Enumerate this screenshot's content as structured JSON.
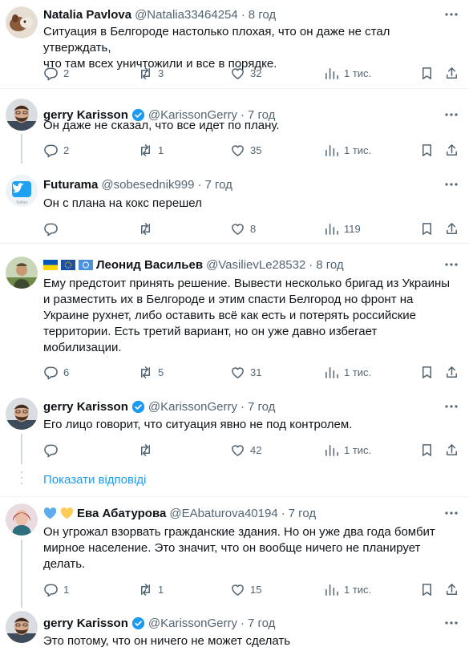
{
  "tweets": [
    {
      "name": "Natalia Pavlova",
      "handle": "@Natalia33464254",
      "time": "8 год",
      "text": "Ситуация в Белгороде настолько плохая, что он даже не стал утверждать,\nчто там всех уничтожили и все в порядке.",
      "replies": "2",
      "retweets": "3",
      "likes": "32",
      "views": "1 тис."
    },
    {
      "name": "gerry Karisson",
      "handle": "@KarissonGerry",
      "time": "7 год",
      "text": "Он даже не сказал, что все идет по плану.",
      "replies": "2",
      "retweets": "1",
      "likes": "35",
      "views": "1 тис."
    },
    {
      "name": "Futurama",
      "handle": "@sobesednik999",
      "time": "7 год",
      "avatar_caption": "Twitter",
      "text": "Он с плана на кокс перешел",
      "replies": "",
      "retweets": "",
      "likes": "8",
      "views": "119"
    },
    {
      "name": "Леонид Васильев",
      "handle": "@VasilievLe28532",
      "time": "8 год",
      "text": "Ему предстоит принять решение. Вывести несколько бригад из Украины\nи разместить их в Белгороде и этим спасти Белгород но фронт на\nУкраине рухнет, либо оставить всё как есть и потерять российские\nтерритории. Есть третий вариант, но он уже давно избегает\nмобилизации.",
      "replies": "6",
      "retweets": "5",
      "likes": "31",
      "views": "1 тис."
    },
    {
      "name": "gerry Karisson",
      "handle": "@KarissonGerry",
      "time": "7 год",
      "text": "Его лицо говорит, что ситуация явно не под контролем.",
      "replies": "",
      "retweets": "",
      "likes": "42",
      "views": "1 тис."
    },
    {
      "name": "Ева Абатурова",
      "handle": "@EAbaturova40194",
      "time": "7 год",
      "text": "Он угрожал взорвать гражданские здания. Но он уже два года бомбит\nмирное население. Это значит, что он вообще ничего не планирует\nделать.",
      "replies": "1",
      "retweets": "1",
      "likes": "15",
      "views": "1 тис."
    },
    {
      "name": "gerry Karisson",
      "handle": "@KarissonGerry",
      "time": "7 год",
      "text": "Это потому, что он ничего не может сделать"
    }
  ],
  "show_replies": "Показати відповіді",
  "colors": {
    "accent": "#1d9bf0",
    "secondary_text": "#536471",
    "verified": "#1d9bf0",
    "divider": "#eff3f4"
  },
  "icons": [
    "reply-icon",
    "retweet-icon",
    "like-icon",
    "views-icon",
    "bookmark-icon",
    "share-icon",
    "more-icon",
    "verified-icon"
  ]
}
